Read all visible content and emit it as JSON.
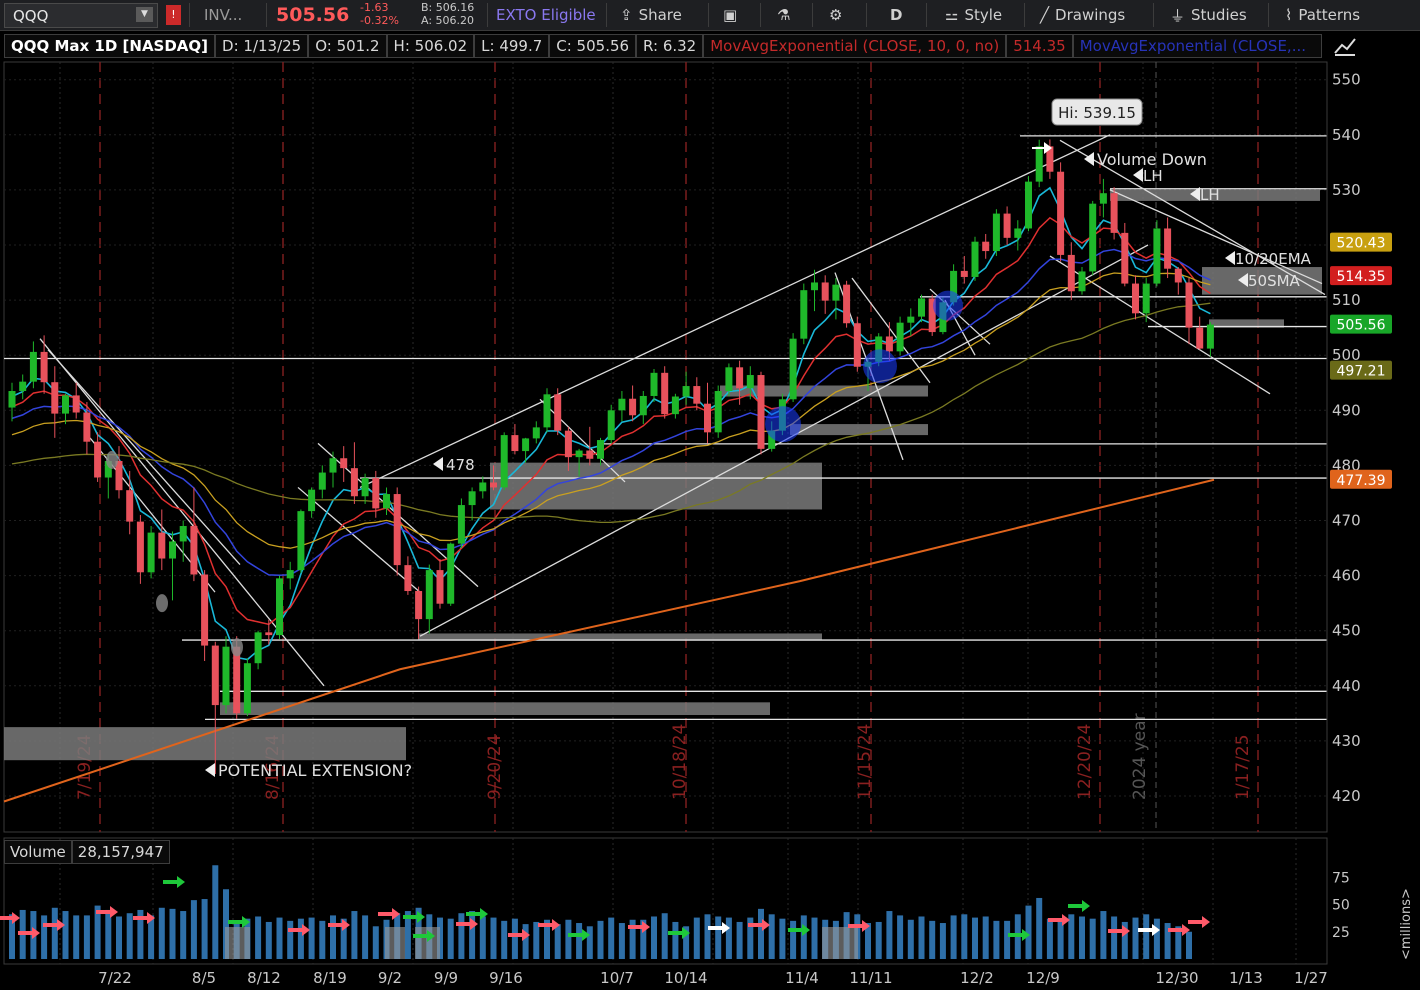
{
  "toolbar": {
    "symbol": "QQQ",
    "flag": "!",
    "inv": "INV...",
    "last": "505.56",
    "change": "-1.63",
    "change_pct": "-0.32%",
    "bid": "B: 506.16",
    "ask": "A: 506.20",
    "exto": "EXTO Eligible",
    "share": "Share",
    "period": "D",
    "style": "Style",
    "drawings": "Drawings",
    "studies": "Studies",
    "patterns": "Patterns"
  },
  "header": {
    "title": "QQQ Max 1D [NASDAQ]",
    "date": "D: 1/13/25",
    "open": "O: 501.2",
    "high": "H: 506.02",
    "low": "L: 499.7",
    "close": "C: 505.56",
    "range": "R: 6.32",
    "ema10": "MovAvgExponential (CLOSE, 10, 0, no)",
    "ema10_val": "514.35",
    "ema20": "MovAvgExponential (CLOSE,..."
  },
  "colors": {
    "up": "#1fb82a",
    "down": "#e8525c",
    "ema10": "#e03030",
    "ema20": "#3344dd",
    "ema_fast": "#19b8d8",
    "sma50": "#7a7a22",
    "sma200": "#e0641c",
    "ema_yel": "#c9a020",
    "grid": "#7a1e1e"
  },
  "chart_data": {
    "type": "candlestick",
    "title": "QQQ Max 1D [NASDAQ]",
    "y_axis": {
      "min": 416,
      "max": 553,
      "ticks": [
        420,
        430,
        440,
        450,
        460,
        470,
        480,
        490,
        500,
        510,
        520,
        530,
        540,
        550
      ]
    },
    "x_axis_labels": [
      "7/22",
      "8/5",
      "8/12",
      "8/19",
      "9/2",
      "9/9",
      "9/16",
      "10/7",
      "10/14",
      "11/4",
      "11/11",
      "12/2",
      "12/9",
      "12/30",
      "1/13",
      "1/27"
    ],
    "vertical_date_labels": [
      "7/19/24",
      "8/16/24",
      "9/20/24",
      "10/18/24",
      "11/15/24",
      "12/20/24",
      "2024 year",
      "1/17/25"
    ],
    "ohlc": [
      [
        490.5,
        495.0,
        488.0,
        493.5
      ],
      [
        493.5,
        496.5,
        492.0,
        495.2
      ],
      [
        495.2,
        502.5,
        494.0,
        500.6
      ],
      [
        500.6,
        503.6,
        493.0,
        495.1
      ],
      [
        495.1,
        498.0,
        485.0,
        489.4
      ],
      [
        489.4,
        493.0,
        487.5,
        492.7
      ],
      [
        492.7,
        495.0,
        488.5,
        489.6
      ],
      [
        489.6,
        491.5,
        482.0,
        484.3
      ],
      [
        484.3,
        486.0,
        477.0,
        477.8
      ],
      [
        477.8,
        482.0,
        474.0,
        480.8
      ],
      [
        480.8,
        483.5,
        474.0,
        475.5
      ],
      [
        475.5,
        479.0,
        467.5,
        469.8
      ],
      [
        469.8,
        471.0,
        458.5,
        460.6
      ],
      [
        460.6,
        469.0,
        459.5,
        467.8
      ],
      [
        467.8,
        472.0,
        461.0,
        463.1
      ],
      [
        463.1,
        468.0,
        455.5,
        466.2
      ],
      [
        466.2,
        470.0,
        462.5,
        469.0
      ],
      [
        469.0,
        476.0,
        459.0,
        460.2
      ],
      [
        460.2,
        461.0,
        444.5,
        447.3
      ],
      [
        447.3,
        448.0,
        424.0,
        436.5
      ],
      [
        436.5,
        449.0,
        435.0,
        447.1
      ],
      [
        447.1,
        449.0,
        434.0,
        435.0
      ],
      [
        435.0,
        445.0,
        434.5,
        444.1
      ],
      [
        444.1,
        450.0,
        443.0,
        449.7
      ],
      [
        449.7,
        452.0,
        447.5,
        449.2
      ],
      [
        449.2,
        460.0,
        448.5,
        459.5
      ],
      [
        459.5,
        462.5,
        457.5,
        461.0
      ],
      [
        461.0,
        472.0,
        460.5,
        471.7
      ],
      [
        471.7,
        476.0,
        470.5,
        475.6
      ],
      [
        475.6,
        480.0,
        474.0,
        478.7
      ],
      [
        478.7,
        482.5,
        476.0,
        481.3
      ],
      [
        481.3,
        483.5,
        477.0,
        479.5
      ],
      [
        479.5,
        484.2,
        473.0,
        474.4
      ],
      [
        474.4,
        478.5,
        473.0,
        477.7
      ],
      [
        477.7,
        479.0,
        470.5,
        472.2
      ],
      [
        472.2,
        476.0,
        471.0,
        474.8
      ],
      [
        474.8,
        476.0,
        460.0,
        461.9
      ],
      [
        461.9,
        463.5,
        456.5,
        457.2
      ],
      [
        457.2,
        458.0,
        448.5,
        452.1
      ],
      [
        452.1,
        462.0,
        449.5,
        461.0
      ],
      [
        461.0,
        463.0,
        454.0,
        454.9
      ],
      [
        454.9,
        466.0,
        454.5,
        465.8
      ],
      [
        465.8,
        474.0,
        465.0,
        472.8
      ],
      [
        472.8,
        476.0,
        470.0,
        475.3
      ],
      [
        475.3,
        478.0,
        474.0,
        476.9
      ],
      [
        476.9,
        480.0,
        475.5,
        476.0
      ],
      [
        476.0,
        486.0,
        475.5,
        485.5
      ],
      [
        485.5,
        487.5,
        482.0,
        482.6
      ],
      [
        482.6,
        485.0,
        480.5,
        484.9
      ],
      [
        484.9,
        488.0,
        484.0,
        486.9
      ],
      [
        486.9,
        494.0,
        486.0,
        492.9
      ],
      [
        492.9,
        494.0,
        485.5,
        486.3
      ],
      [
        486.3,
        487.0,
        479.0,
        481.5
      ],
      [
        481.5,
        483.0,
        478.0,
        482.7
      ],
      [
        482.7,
        487.0,
        480.0,
        481.2
      ],
      [
        481.2,
        485.0,
        480.0,
        484.6
      ],
      [
        484.6,
        491.0,
        484.0,
        490.0
      ],
      [
        490.0,
        493.5,
        488.0,
        492.1
      ],
      [
        492.1,
        494.5,
        488.0,
        489.1
      ],
      [
        489.1,
        493.5,
        487.5,
        492.6
      ],
      [
        492.6,
        497.5,
        491.5,
        496.8
      ],
      [
        496.8,
        498.0,
        488.5,
        489.3
      ],
      [
        489.3,
        493.0,
        488.5,
        492.5
      ],
      [
        492.5,
        497.0,
        491.0,
        494.4
      ],
      [
        494.4,
        496.0,
        490.0,
        491.2
      ],
      [
        491.2,
        495.0,
        484.0,
        486.0
      ],
      [
        486.0,
        494.5,
        485.0,
        493.5
      ],
      [
        493.5,
        498.5,
        492.5,
        497.8
      ],
      [
        497.8,
        499.0,
        491.0,
        494.0
      ],
      [
        494.0,
        498.0,
        492.0,
        496.4
      ],
      [
        496.4,
        497.0,
        482.0,
        483.0
      ],
      [
        483.0,
        488.0,
        482.5,
        486.3
      ],
      [
        486.3,
        493.0,
        485.5,
        492.0
      ],
      [
        492.0,
        504.0,
        491.5,
        503.0
      ],
      [
        503.0,
        513.0,
        502.0,
        511.8
      ],
      [
        511.8,
        515.5,
        508.0,
        513.2
      ],
      [
        513.2,
        514.5,
        507.5,
        509.9
      ],
      [
        509.9,
        514.0,
        506.5,
        512.8
      ],
      [
        512.8,
        513.5,
        505.0,
        505.8
      ],
      [
        505.8,
        507.0,
        497.0,
        497.9
      ],
      [
        497.9,
        499.5,
        493.5,
        498.8
      ],
      [
        498.8,
        504.0,
        498.0,
        503.4
      ],
      [
        503.4,
        506.0,
        499.0,
        500.7
      ],
      [
        500.7,
        507.0,
        500.0,
        505.9
      ],
      [
        505.9,
        508.5,
        503.5,
        507.0
      ],
      [
        507.0,
        511.0,
        506.0,
        510.3
      ],
      [
        510.3,
        511.0,
        503.5,
        504.2
      ],
      [
        504.2,
        510.5,
        503.8,
        509.6
      ],
      [
        509.6,
        516.5,
        509.0,
        515.3
      ],
      [
        515.3,
        518.0,
        513.0,
        514.2
      ],
      [
        514.2,
        521.5,
        513.5,
        520.6
      ],
      [
        520.6,
        522.0,
        517.5,
        518.9
      ],
      [
        518.9,
        526.5,
        518.0,
        525.7
      ],
      [
        525.7,
        527.0,
        520.0,
        521.3
      ],
      [
        521.3,
        524.5,
        519.0,
        523.0
      ],
      [
        523.0,
        532.5,
        522.5,
        531.5
      ],
      [
        531.5,
        539.1,
        530.5,
        537.9
      ],
      [
        537.9,
        539.15,
        532.0,
        533.3
      ],
      [
        533.3,
        535.0,
        517.0,
        518.2
      ],
      [
        518.2,
        520.5,
        510.0,
        511.6
      ],
      [
        511.6,
        516.0,
        511.0,
        515.2
      ],
      [
        515.2,
        528.0,
        514.5,
        527.5
      ],
      [
        527.5,
        532.0,
        525.0,
        529.4
      ],
      [
        529.4,
        530.5,
        521.0,
        522.2
      ],
      [
        522.2,
        524.0,
        512.5,
        513.0
      ],
      [
        513.0,
        514.5,
        506.5,
        507.6
      ],
      [
        507.6,
        514.0,
        506.0,
        513.0
      ],
      [
        513.0,
        524.5,
        512.5,
        523.0
      ],
      [
        523.0,
        525.0,
        514.0,
        515.7
      ],
      [
        515.7,
        516.0,
        511.0,
        513.2
      ],
      [
        513.2,
        514.0,
        502.0,
        505.0
      ],
      [
        505.0,
        507.0,
        501.0,
        501.2
      ],
      [
        501.2,
        506.02,
        499.7,
        505.56
      ]
    ],
    "volume_axis": {
      "unit": "millions",
      "ticks": [
        25,
        50,
        75
      ]
    },
    "volume": [
      41,
      45,
      44,
      40,
      47,
      44,
      40,
      40,
      49,
      45,
      39,
      42,
      45,
      40,
      47,
      46,
      44,
      54,
      55,
      86,
      64,
      35,
      37,
      39,
      34,
      38,
      35,
      37,
      38,
      35,
      40,
      37,
      44,
      40,
      30,
      36,
      42,
      44,
      47,
      41,
      38,
      37,
      42,
      44,
      39,
      38,
      35,
      37,
      32,
      34,
      36,
      32,
      36,
      33,
      30,
      35,
      38,
      33,
      36,
      36,
      39,
      42,
      34,
      30,
      38,
      41,
      39,
      38,
      34,
      38,
      46,
      41,
      37,
      35,
      40,
      38,
      36,
      35,
      43,
      41,
      33,
      34,
      44,
      40,
      36,
      39,
      35,
      33,
      40,
      41,
      38,
      39,
      35,
      35,
      41,
      49,
      56,
      37,
      36,
      41,
      39,
      37,
      44,
      39,
      34,
      38,
      41,
      37,
      33,
      30,
      25
    ],
    "volume_stat": "28,157,947",
    "price_tags": [
      {
        "text": "520.43",
        "value": 520.43,
        "color": "#c8a010"
      },
      {
        "text": "514.35",
        "value": 514.35,
        "color": "#d21f1f"
      },
      {
        "text": "505.56",
        "value": 505.56,
        "color": "#18a628"
      },
      {
        "text": "497.21",
        "value": 497.21,
        "color": "#6a6a18"
      },
      {
        "text": "477.39",
        "value": 477.39,
        "color": "#e0641c"
      }
    ],
    "annotations": {
      "hi": "Hi: 539.15",
      "volume_down": "Volume Down",
      "lh1": "LH",
      "lh2": "LH",
      "ema_label": "10/20EMA",
      "sma_label": "50SMA",
      "level_478": "478",
      "potential": "POTENTIAL EXTENSION?",
      "volume_label": "Volume"
    }
  }
}
